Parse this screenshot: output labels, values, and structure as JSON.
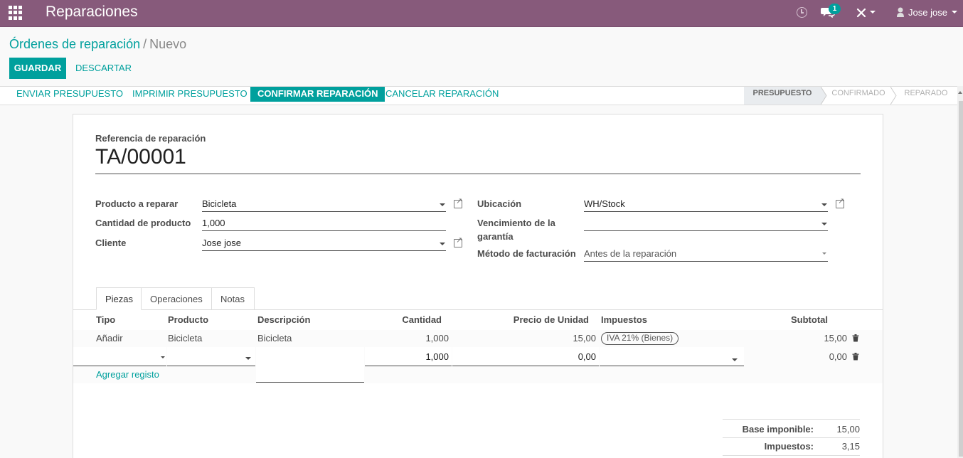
{
  "navbar": {
    "app_title": "Reparaciones",
    "messages_badge": "1",
    "user_name": "Jose jose"
  },
  "breadcrumb": {
    "parent": "Órdenes de reparación",
    "separator": "/",
    "current": "Nuevo"
  },
  "buttons": {
    "save": "GUARDAR",
    "discard": "DESCARTAR"
  },
  "statusbar": {
    "actions": [
      "ENVIAR PRESUPUESTO",
      "IMPRIMIR PRESUPUESTO",
      "CONFIRMAR REPARACIÓN",
      "CANCELAR REPARACIÓN"
    ],
    "stages": [
      "PRESUPUESTO",
      "CONFIRMADO",
      "REPARADO"
    ],
    "active_stage": "PRESUPUESTO"
  },
  "form": {
    "reference_label": "Referencia de reparación",
    "reference_value": "TA/00001",
    "product_label": "Producto a reparar",
    "product_value": "Bicicleta",
    "quantity_label": "Cantidad de producto",
    "quantity_value": "1,000",
    "customer_label": "Cliente",
    "customer_value": "Jose jose",
    "location_label": "Ubicación",
    "location_value": "WH/Stock",
    "warranty_label_1": "Vencimiento de la",
    "warranty_label_2": "garantía",
    "warranty_value": "",
    "invoice_method_label": "Método de facturación",
    "invoice_method_value": "Antes de la reparación"
  },
  "tabs": [
    "Piezas",
    "Operaciones",
    "Notas"
  ],
  "table": {
    "headers": {
      "type": "Tipo",
      "product": "Producto",
      "description": "Descripción",
      "quantity": "Cantidad",
      "unit_price": "Precio de Unidad",
      "taxes": "Impuestos",
      "subtotal": "Subtotal"
    },
    "rows": [
      {
        "type": "Añadir",
        "product": "Bicicleta",
        "description": "Bicicleta",
        "quantity": "1,000",
        "unit_price": "15,00",
        "tax": "IVA 21% (Bienes)",
        "subtotal": "15,00"
      }
    ],
    "edit_row": {
      "quantity": "1,000",
      "unit_price": "0,00",
      "subtotal": "0,00"
    },
    "add_line": "Agregar registo"
  },
  "totals": {
    "base_label": "Base imponible:",
    "base_value": "15,00",
    "tax_label": "Impuestos:",
    "tax_value": "3,15"
  },
  "colors": {
    "navbar": "#875a7b",
    "accent": "#00a09d"
  }
}
